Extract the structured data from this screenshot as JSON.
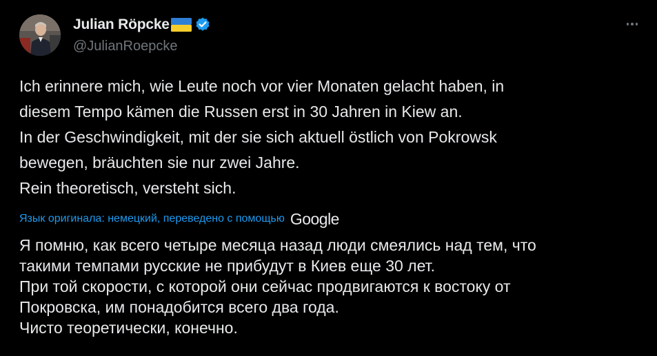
{
  "author": {
    "display_name": "Julian Röpcke",
    "handle": "@JulianRoepcke",
    "flag_icon": "ukraine-flag-icon",
    "verified_icon": "verified-badge-icon",
    "verified_color": "#1d9bf0"
  },
  "menu": {
    "more_icon": "more-horizontal-icon"
  },
  "tweet": {
    "original_lines": [
      "Ich erinnere mich, wie Leute noch vor vier Monaten gelacht haben, in",
      "diesem Tempo kämen die Russen erst in 30 Jahren in Kiew an.",
      "In der Geschwindigkeit, mit der sie sich aktuell östlich von Pokrowsk",
      "bewegen, bräuchten sie nur zwei Jahre.",
      "Rein theoretisch, versteht sich."
    ],
    "translation_note": "Язык оригинала: немецкий, переведено с помощью",
    "translation_provider": "Google",
    "translated_lines": [
      "Я помню, как всего четыре месяца назад люди смеялись над тем, что",
      "такими темпами русские не прибудут в Киев еще 30 лет.",
      "При той скорости, с которой они сейчас продвигаются к востоку от",
      "Покровска, им понадобится всего два года.",
      "Чисто теоретически, конечно."
    ]
  },
  "colors": {
    "background": "#000000",
    "text_primary": "#e7e9ea",
    "text_secondary": "#71767b",
    "link": "#1d9bf0"
  }
}
